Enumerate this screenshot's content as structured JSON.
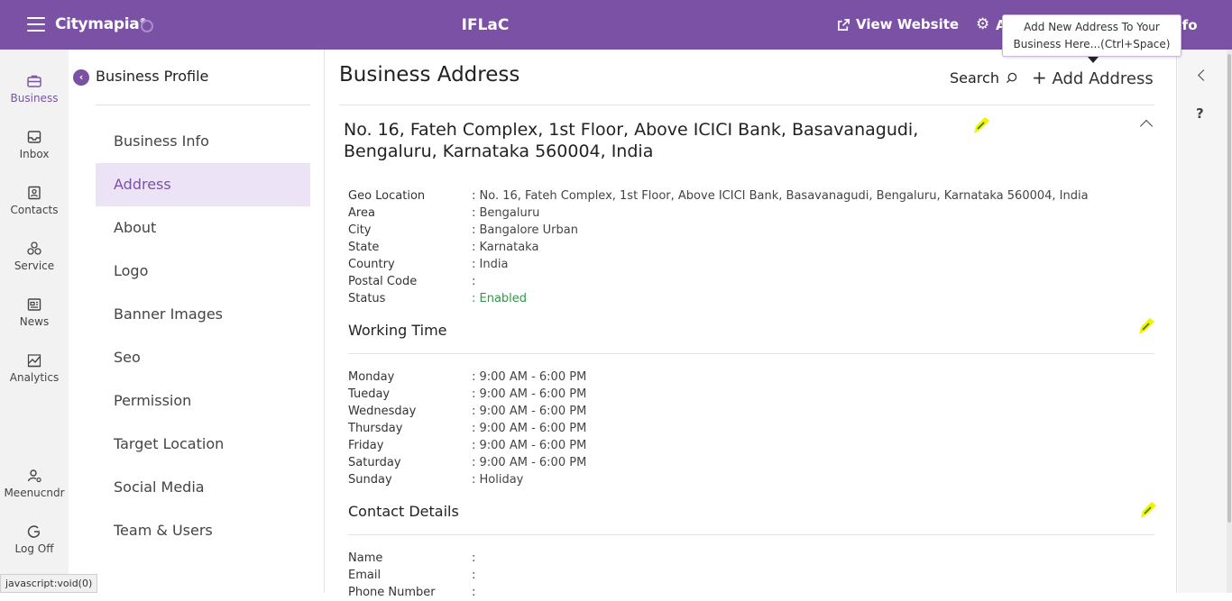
{
  "topbar": {
    "logo": "Citymapia",
    "logo_sup": "®",
    "app_title": "IFLaC",
    "view_website": "View Website",
    "gear_text": "Al",
    "info_text": "nfo",
    "tooltip_line1": "Add New Address To Your",
    "tooltip_line2": "Business Here...(Ctrl+Space)"
  },
  "leftnav": {
    "items": [
      {
        "label": "Business",
        "icon": "briefcase-icon"
      },
      {
        "label": "Inbox",
        "icon": "inbox-icon"
      },
      {
        "label": "Contacts",
        "icon": "contacts-icon"
      },
      {
        "label": "Service",
        "icon": "service-icon"
      },
      {
        "label": "News",
        "icon": "news-icon"
      },
      {
        "label": "Analytics",
        "icon": "analytics-icon"
      }
    ],
    "user": "Meenucndr",
    "logoff": "Log Off"
  },
  "profile": {
    "title": "Business Profile",
    "menu": [
      "Business Info",
      "Address",
      "About",
      "Logo",
      "Banner Images",
      "Seo",
      "Permission",
      "Target Location",
      "Social Media",
      "Team & Users"
    ],
    "active": "Address"
  },
  "main": {
    "title": "Business Address",
    "search": "Search",
    "add_address": "Add Address",
    "address_heading_line1": "No. 16, Fateh Complex, 1st Floor, Above ICICI Bank, Basavanagudi,",
    "address_heading_line2": "Bengaluru, Karnataka 560004, India",
    "details": [
      {
        "k": "Geo Location",
        "v": ": No. 16, Fateh Complex, 1st Floor, Above ICICI Bank, Basavanagudi, Bengaluru, Karnataka 560004, India"
      },
      {
        "k": "Area",
        "v": ": Bengaluru"
      },
      {
        "k": "City",
        "v": ": Bangalore Urban"
      },
      {
        "k": "State",
        "v": ": Karnataka"
      },
      {
        "k": "Country",
        "v": ": India"
      },
      {
        "k": "Postal Code",
        "v": ":"
      },
      {
        "k": "Status",
        "v": ": Enabled"
      }
    ],
    "working_time_title": "Working Time",
    "working_time": [
      {
        "k": "Monday",
        "v": ": 9:00 AM - 6:00 PM"
      },
      {
        "k": "Tueday",
        "v": ": 9:00 AM - 6:00 PM"
      },
      {
        "k": "Wednesday",
        "v": ": 9:00 AM - 6:00 PM"
      },
      {
        "k": "Thursday",
        "v": ": 9:00 AM - 6:00 PM"
      },
      {
        "k": "Friday",
        "v": ": 9:00 AM - 6:00 PM"
      },
      {
        "k": "Saturday",
        "v": ": 9:00 AM - 6:00 PM"
      },
      {
        "k": "Sunday",
        "v": ": Holiday"
      }
    ],
    "contact_title": "Contact Details",
    "contact": [
      {
        "k": "Name",
        "v": ":"
      },
      {
        "k": "Email",
        "v": ":"
      },
      {
        "k": "Phone Number",
        "v": ":"
      }
    ]
  },
  "statusbar": "javascript:void(0)",
  "colors": {
    "brand": "#7b51a6",
    "status_enabled": "#2e9a46",
    "edit_highlight": "#f2f200"
  }
}
